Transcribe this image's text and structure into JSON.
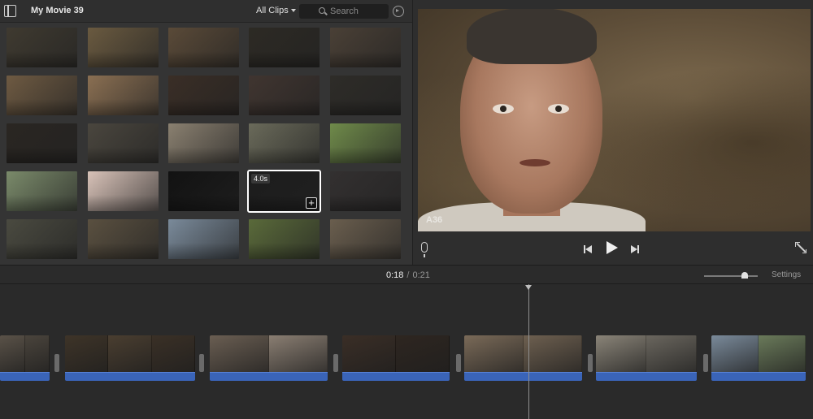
{
  "browser": {
    "project_title": "My Movie 39",
    "clip_filter": "All Clips",
    "search": {
      "placeholder": "Search",
      "value": ""
    },
    "selected_clip": {
      "duration": "4.0s"
    },
    "clip_colors": [
      [
        "#3f3a30",
        "#6a5a40",
        "#5a4a38",
        "#2d2a24",
        "#4a4036"
      ],
      [
        "#6e5a42",
        "#8a6f52",
        "#3a2e26",
        "#403530",
        "#2e2c28"
      ],
      [
        "#2a2622",
        "#4a463e",
        "#8a8070",
        "#6a6a5a",
        "#6f8a4a"
      ],
      [
        "#7a8a6a",
        "#d8c2b8",
        "#121212",
        "#1c1c1c",
        "#333030"
      ],
      [
        "#4a4a40",
        "#5a5040",
        "#7a8a9a",
        "#5a6a3a",
        "#6a5e4e"
      ]
    ]
  },
  "viewer": {
    "watermark": "A36"
  },
  "timeline_bar": {
    "current": "0:18",
    "separator": "/",
    "total": "0:21",
    "settings": "Settings",
    "zoom_level": 0.75
  },
  "timeline": {
    "clips": [
      {
        "frames": [
          "#5a5248",
          "#4a443c"
        ]
      },
      {
        "frames": [
          "#3e3428",
          "#4a3e30",
          "#3a3026"
        ]
      },
      {
        "frames": [
          "#6a5e52",
          "#8a7e72"
        ]
      },
      {
        "frames": [
          "#3a2e26",
          "#2e2620"
        ]
      },
      {
        "frames": [
          "#7a6a58",
          "#6e6050"
        ]
      },
      {
        "frames": [
          "#8a8478",
          "#6a665e"
        ]
      },
      {
        "frames": [
          "#7a8a9a",
          "#6a7a5a"
        ]
      }
    ]
  }
}
